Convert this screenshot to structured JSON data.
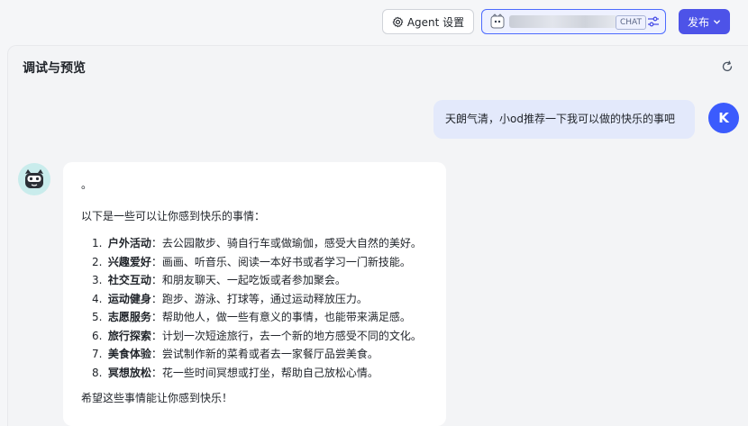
{
  "toolbar": {
    "agent_settings_label": "Agent 设置",
    "model_tag": "CHAT",
    "publish_label": "发布"
  },
  "panel": {
    "title": "调试与预览"
  },
  "chat": {
    "user_initial": "K",
    "user_message": "天朗气清，小od推荐一下我可以做的快乐的事吧",
    "bot": {
      "first_line": "。",
      "intro": "以下是一些可以让你感到快乐的事情：",
      "items": [
        {
          "num": "1.",
          "key": "户外活动",
          "text": "：去公园散步、骑自行车或做瑜伽，感受大自然的美好。"
        },
        {
          "num": "2.",
          "key": "兴趣爱好",
          "text": "：画画、听音乐、阅读一本好书或者学习一门新技能。"
        },
        {
          "num": "3.",
          "key": "社交互动",
          "text": "：和朋友聊天、一起吃饭或者参加聚会。"
        },
        {
          "num": "4.",
          "key": "运动健身",
          "text": "：跑步、游泳、打球等，通过运动释放压力。"
        },
        {
          "num": "5.",
          "key": "志愿服务",
          "text": "：帮助他人，做一些有意义的事情，也能带来满足感。"
        },
        {
          "num": "6.",
          "key": "旅行探索",
          "text": "：计划一次短途旅行，去一个新的地方感受不同的文化。"
        },
        {
          "num": "7.",
          "key": "美食体验",
          "text": "：尝试制作新的菜肴或者去一家餐厅品尝美食。"
        },
        {
          "num": "8.",
          "key": "冥想放松",
          "text": "：花一些时间冥想或打坐，帮助自己放松心情。"
        }
      ],
      "outro": "希望这些事情能让你感到快乐！"
    }
  },
  "colors": {
    "accent": "#4d53e8",
    "user_avatar": "#3b5bfd",
    "user_bubble": "#e3e9fb"
  }
}
